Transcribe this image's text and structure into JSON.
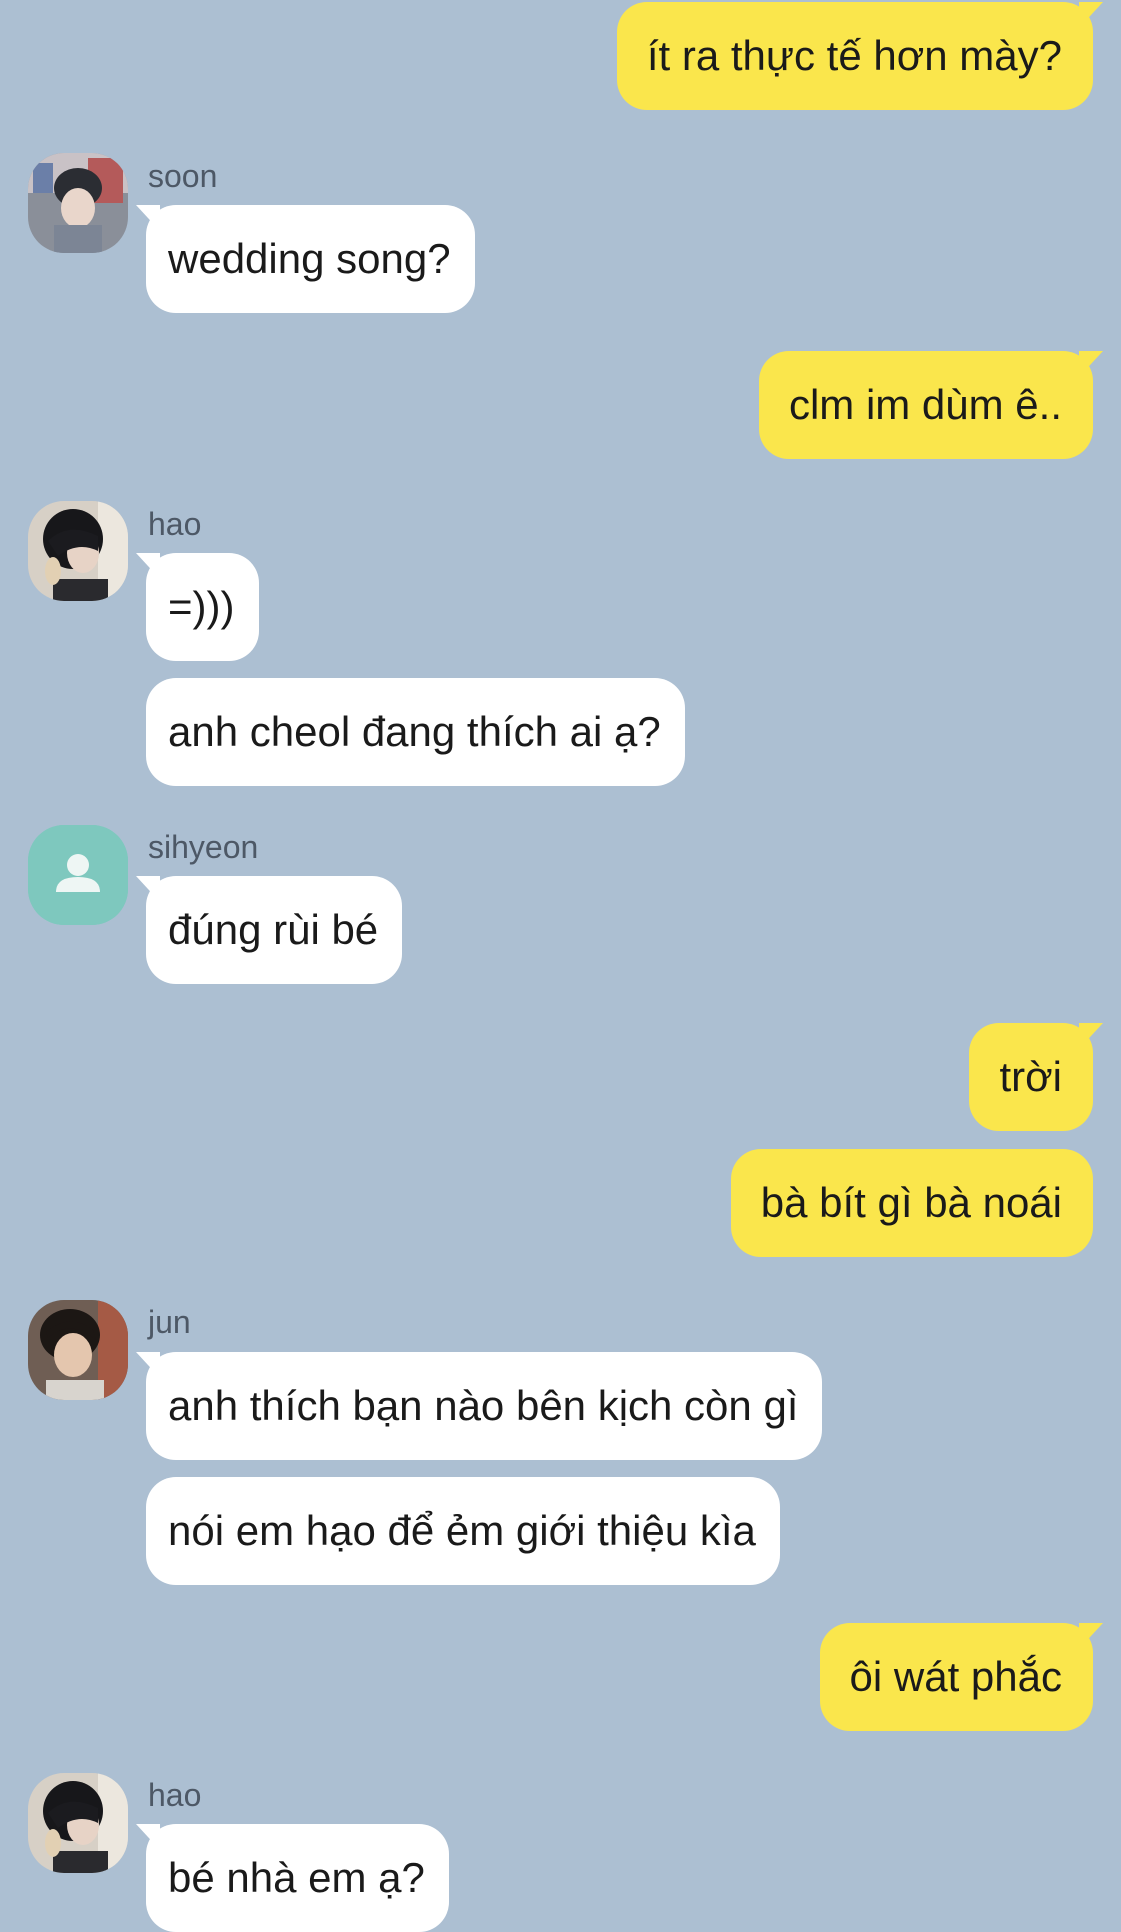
{
  "colors": {
    "background": "#acbfd2",
    "outgoing_bubble": "#fae64c",
    "incoming_bubble": "#ffffff",
    "sender_name": "#4d5866",
    "default_avatar": "#7ec8be"
  },
  "messages": [
    {
      "direction": "out",
      "text": "ít ra thực tế hơn mày?"
    },
    {
      "direction": "in",
      "sender": "soon",
      "avatar": "photo-avatar",
      "text": "wedding song?"
    },
    {
      "direction": "out",
      "text": "clm im dùm ê.."
    },
    {
      "direction": "in",
      "sender": "hao",
      "avatar": "photo-avatar",
      "text": "=)))"
    },
    {
      "direction": "in",
      "text": "anh cheol đang thích ai ạ?"
    },
    {
      "direction": "in",
      "sender": "sihyeon",
      "avatar": "default-person-icon",
      "text": "đúng rùi bé"
    },
    {
      "direction": "out",
      "text": "trời"
    },
    {
      "direction": "out",
      "text": "bà bít gì bà noái"
    },
    {
      "direction": "in",
      "sender": "jun",
      "avatar": "photo-avatar",
      "text": "anh thích bạn nào bên kịch còn gì"
    },
    {
      "direction": "in",
      "text": "nói em hạo để ẻm giới thiệu kìa"
    },
    {
      "direction": "out",
      "text": "ôi wát phắc"
    },
    {
      "direction": "in",
      "sender": "hao",
      "avatar": "photo-avatar",
      "text": "bé nhà em ạ?"
    }
  ]
}
